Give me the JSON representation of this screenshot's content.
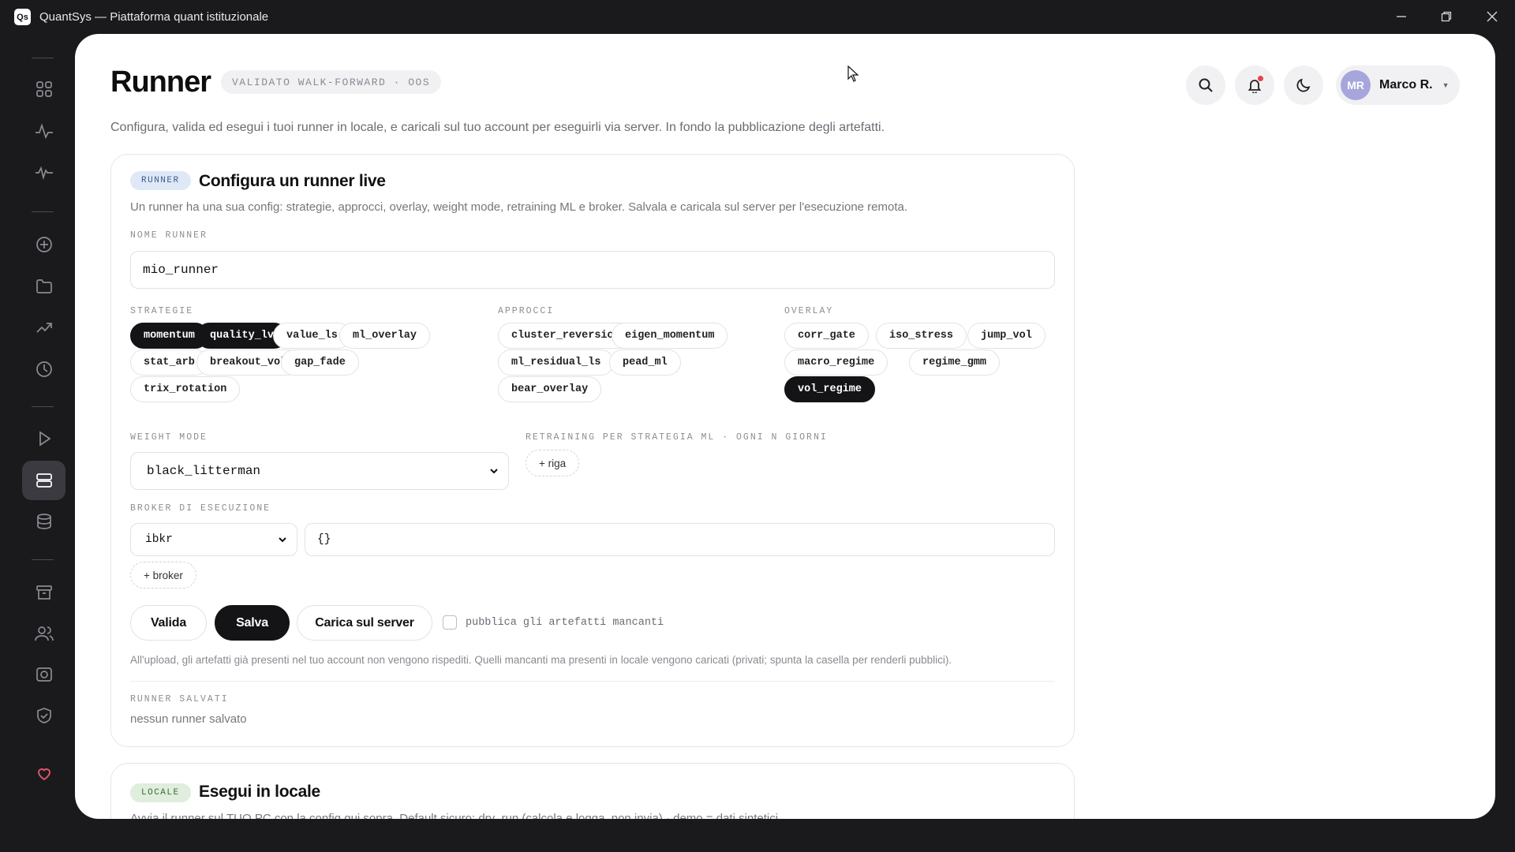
{
  "window": {
    "logo": "Qs",
    "title": "QuantSys — Piattaforma quant istituzionale"
  },
  "sidebar": {
    "items": [
      {
        "icon": "grid-icon"
      },
      {
        "icon": "pulse-icon"
      },
      {
        "icon": "heartbeat-icon"
      },
      {
        "icon": "plus-circle-icon"
      },
      {
        "icon": "folder-icon"
      },
      {
        "icon": "trending-up-icon"
      },
      {
        "icon": "clock-icon"
      },
      {
        "icon": "play-icon"
      },
      {
        "icon": "server-icon",
        "active": true
      },
      {
        "icon": "database-icon"
      },
      {
        "icon": "archive-icon"
      },
      {
        "icon": "users-icon"
      },
      {
        "icon": "camera-icon"
      },
      {
        "icon": "shield-check-icon"
      },
      {
        "icon": "heart-icon",
        "color": "#e0566a"
      }
    ]
  },
  "header": {
    "title": "Runner",
    "badge": "VALIDATO WALK-FORWARD · OOS",
    "description": "Configura, valida ed esegui i tuoi runner in locale, e caricali sul tuo account per eseguirli via server. In fondo la pubblicazione degli artefatti.",
    "user": {
      "initials": "MR",
      "name": "Marco R."
    }
  },
  "config_card": {
    "tag": "RUNNER",
    "title": "Configura un runner live",
    "subtitle": "Un runner ha una sua config: strategie, approcci, overlay, weight mode, retraining ML e broker. Salvala e caricala sul server per l'esecuzione remota.",
    "name_label": "NOME RUNNER",
    "name_value": "mio_runner",
    "strategies_label": "STRATEGIE",
    "strategies": [
      {
        "label": "momentum",
        "selected": true
      },
      {
        "label": "quality_lv",
        "selected": true
      },
      {
        "label": "value_ls",
        "selected": false
      },
      {
        "label": "ml_overlay",
        "selected": false
      },
      {
        "label": "stat_arb",
        "selected": false
      },
      {
        "label": "breakout_vol",
        "selected": false
      },
      {
        "label": "gap_fade",
        "selected": false
      },
      {
        "label": "trix_rotation",
        "selected": false
      }
    ],
    "approaches_label": "APPROCCI",
    "approaches": [
      {
        "label": "cluster_reversion",
        "selected": false
      },
      {
        "label": "eigen_momentum",
        "selected": false
      },
      {
        "label": "ml_residual_ls",
        "selected": false
      },
      {
        "label": "pead_ml",
        "selected": false
      },
      {
        "label": "bear_overlay",
        "selected": false
      }
    ],
    "overlay_label": "OVERLAY",
    "overlays": [
      {
        "label": "corr_gate",
        "selected": false
      },
      {
        "label": "iso_stress",
        "selected": false
      },
      {
        "label": "jump_vol",
        "selected": false
      },
      {
        "label": "macro_regime",
        "selected": false
      },
      {
        "label": "regime_gmm",
        "selected": false
      },
      {
        "label": "vol_regime",
        "selected": true
      }
    ],
    "weight_mode_label": "WEIGHT MODE",
    "weight_mode_value": "black_litterman",
    "retraining_label": "RETRAINING PER STRATEGIA ML · OGNI N GIORNI",
    "add_row_label": "+ riga",
    "broker_label": "BROKER DI ESECUZIONE",
    "broker_value": "ibkr",
    "broker_config": "{}",
    "add_broker_label": "+ broker",
    "validate_label": "Valida",
    "save_label": "Salva",
    "upload_label": "Carica sul server",
    "publish_label": "pubblica gli artefatti mancanti",
    "publish_checked": false,
    "upload_note": "All'upload, gli artefatti già presenti nel tuo account non vengono rispediti. Quelli mancanti ma presenti in locale vengono caricati (privati; spunta la casella per renderli pubblici).",
    "saved_label": "RUNNER SALVATI",
    "saved_empty": "nessun runner salvato"
  },
  "local_card": {
    "tag": "LOCALE",
    "title": "Esegui in locale",
    "subtitle": "Avvia il runner sul TUO PC con la config qui sopra. Default sicuro: dry_run (calcola e logga, non invia) · demo = dati sintetici."
  }
}
